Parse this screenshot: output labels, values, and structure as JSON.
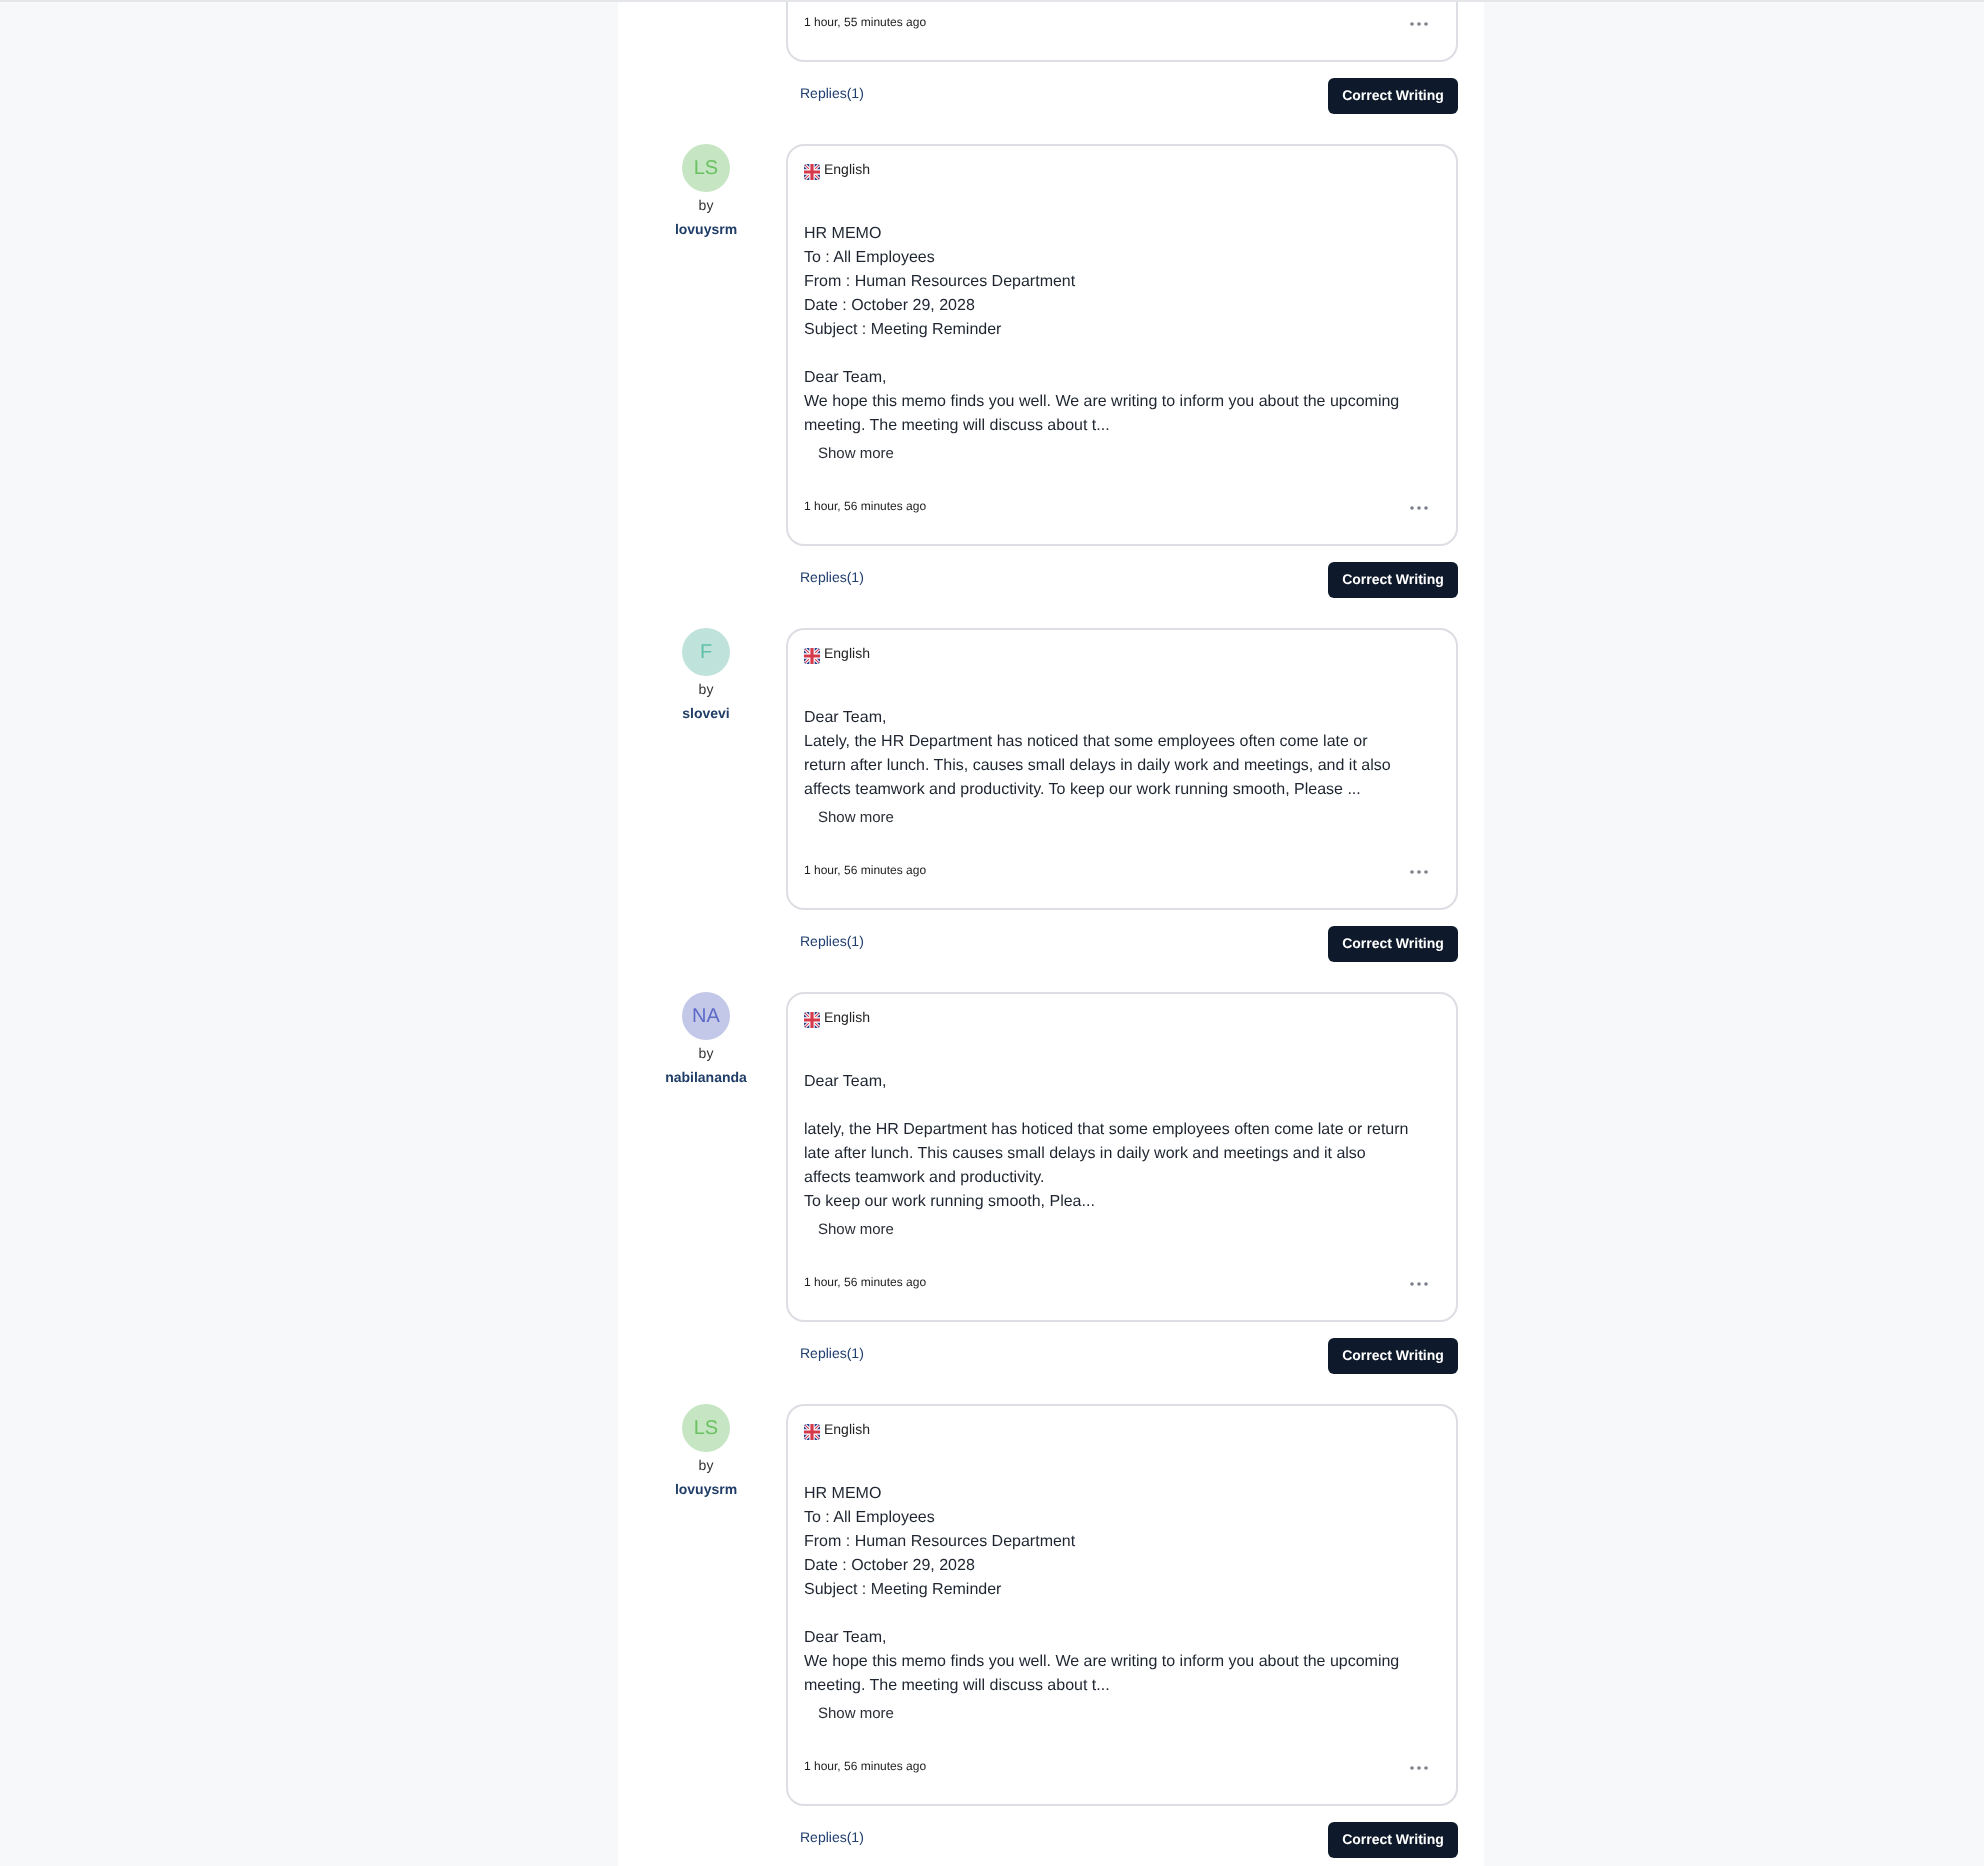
{
  "posts": [
    {
      "time": "1 hour, 55 minutes ago",
      "replies": "Replies(1)",
      "action": "Correct Writing"
    },
    {
      "author": {
        "initials": "LS",
        "by": "by",
        "username": "lovuysrm",
        "color": "#c6e5c3"
      },
      "language": "English",
      "body": "HR MEMO\nTo : All Employees\nFrom : Human Resources Department\nDate : October 29, 2028\nSubject : Meeting Reminder\n\nDear Team,\nWe hope this memo finds you well. We are writing to inform you about the upcoming\nmeeting. The meeting will discuss about t...",
      "show_more": "Show more",
      "time": "1 hour, 56 minutes ago",
      "replies": "Replies(1)",
      "action": "Correct Writing"
    },
    {
      "author": {
        "initials": "F",
        "by": "by",
        "username": "slovevi",
        "color": "#bfe3db"
      },
      "language": "English",
      "body": "Dear Team,\nLately, the HR Department has noticed that some employees often come late or\nreturn after lunch. This, causes small delays in daily work and meetings, and it also\naffects teamwork and productivity. To keep our work running smooth, Please ...",
      "show_more": "Show more",
      "time": "1 hour, 56 minutes ago",
      "replies": "Replies(1)",
      "action": "Correct Writing"
    },
    {
      "author": {
        "initials": "NA",
        "by": "by",
        "username": "nabilananda",
        "color": "#c3c7e8"
      },
      "language": "English",
      "body": "Dear Team,\n\nlately, the HR Department has hoticed that some employees often come late or return\nlate after lunch. This causes small delays in daily work and meetings and it also\naffects teamwork and productivity.\nTo keep our work running smooth, Plea...",
      "show_more": "Show more",
      "time": "1 hour, 56 minutes ago",
      "replies": "Replies(1)",
      "action": "Correct Writing"
    },
    {
      "author": {
        "initials": "LS",
        "by": "by",
        "username": "lovuysrm",
        "color": "#c6e5c3"
      },
      "language": "English",
      "body": "HR MEMO\nTo : All Employees\nFrom : Human Resources Department\nDate : October 29, 2028\nSubject : Meeting Reminder\n\nDear Team,\nWe hope this memo finds you well. We are writing to inform you about the upcoming\nmeeting. The meeting will discuss about t...",
      "show_more": "Show more",
      "time": "1 hour, 56 minutes ago",
      "replies": "Replies(1)",
      "action": "Correct Writing"
    }
  ]
}
